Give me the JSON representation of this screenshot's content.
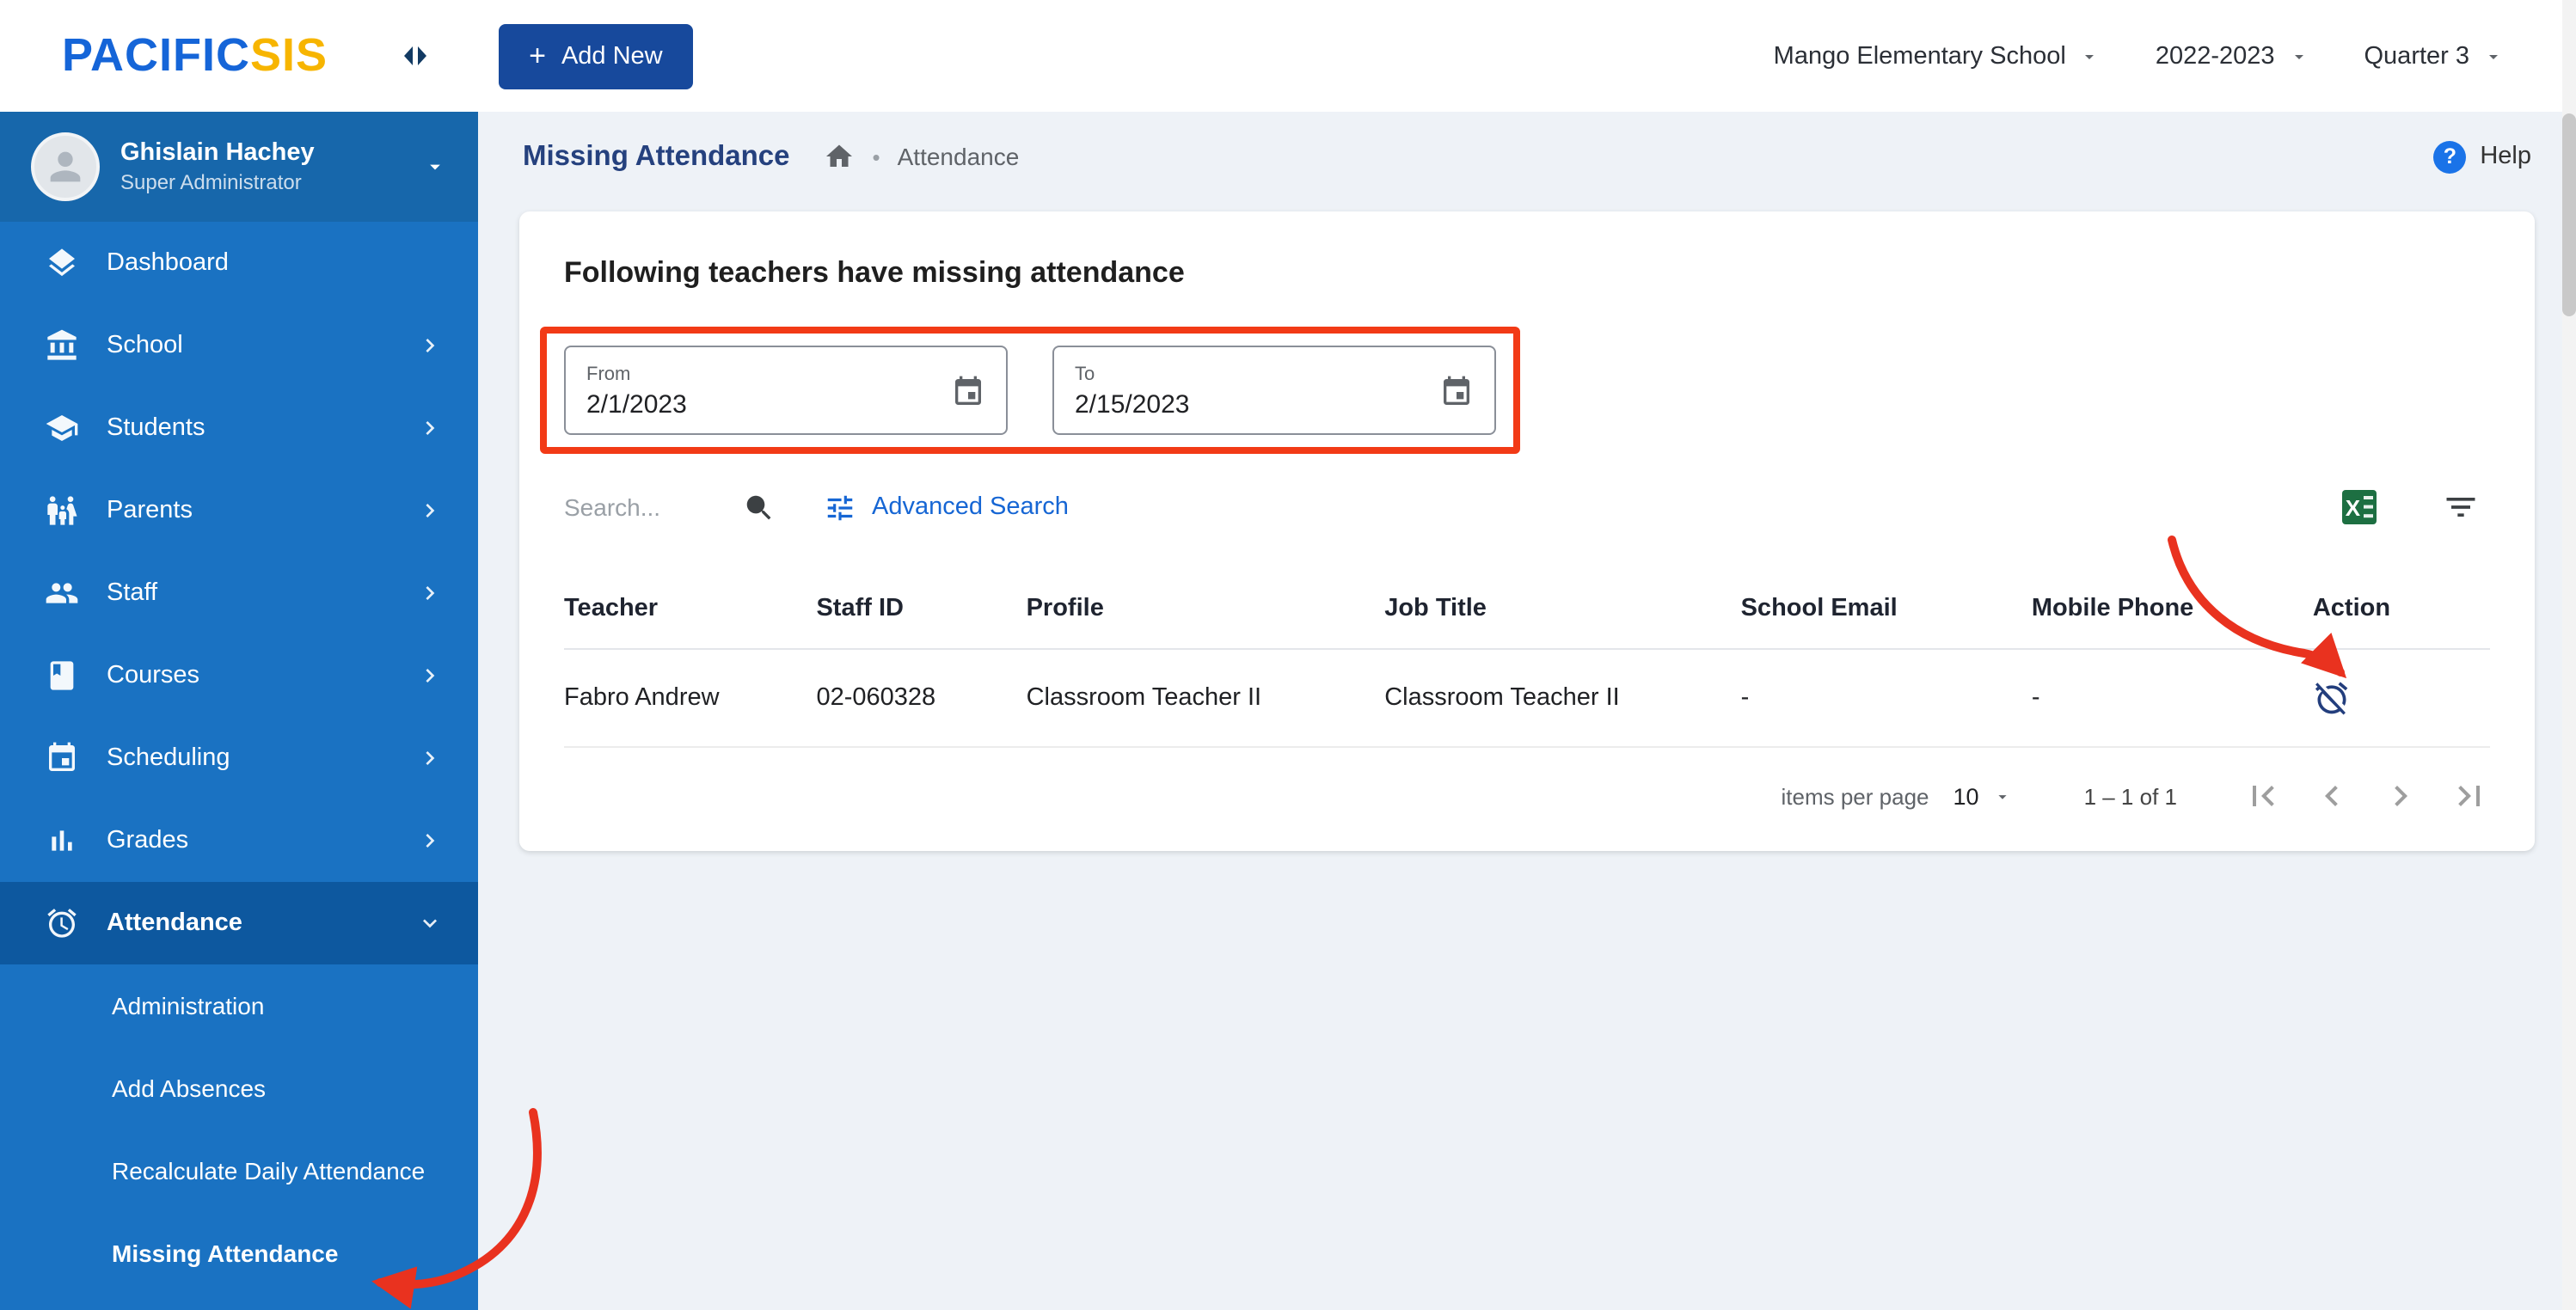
{
  "header": {
    "logo_primary": "PACIFIC",
    "logo_secondary": "SIS",
    "add_new_label": "Add New",
    "school": "Mango Elementary School",
    "year": "2022-2023",
    "quarter": "Quarter 3"
  },
  "sidebar": {
    "user": {
      "name": "Ghislain Hachey",
      "role": "Super Administrator"
    },
    "items": [
      {
        "label": "Dashboard"
      },
      {
        "label": "School"
      },
      {
        "label": "Students"
      },
      {
        "label": "Parents"
      },
      {
        "label": "Staff"
      },
      {
        "label": "Courses"
      },
      {
        "label": "Scheduling"
      },
      {
        "label": "Grades"
      },
      {
        "label": "Attendance"
      }
    ],
    "attendance_children": [
      {
        "label": "Administration"
      },
      {
        "label": "Add Absences"
      },
      {
        "label": "Recalculate Daily Attendance"
      },
      {
        "label": "Missing Attendance"
      }
    ]
  },
  "page": {
    "title": "Missing Attendance",
    "breadcrumb": "Attendance",
    "help_label": "Help"
  },
  "panel": {
    "title": "Following teachers have missing attendance",
    "date_from": {
      "label": "From",
      "value": "2/1/2023"
    },
    "date_to": {
      "label": "To",
      "value": "2/15/2023"
    },
    "search_placeholder": "Search...",
    "advanced_search_label": "Advanced Search"
  },
  "table": {
    "columns": [
      "Teacher",
      "Staff ID",
      "Profile",
      "Job Title",
      "School Email",
      "Mobile Phone",
      "Action"
    ],
    "rows": [
      {
        "teacher": "Fabro Andrew",
        "staff_id": "02-060328",
        "profile": "Classroom Teacher II",
        "job_title": "Classroom Teacher II",
        "school_email": "-",
        "mobile_phone": "-"
      }
    ]
  },
  "pagination": {
    "items_per_page_label": "items per page",
    "items_per_page_value": "10",
    "range": "1 – 1 of 1"
  },
  "colors": {
    "sidebar_blue": "#1a72c2",
    "accent_blue": "#1a73e8",
    "navy_button": "#17499c",
    "annotation_red": "#f23a16",
    "excel_green": "#1d6f42"
  }
}
